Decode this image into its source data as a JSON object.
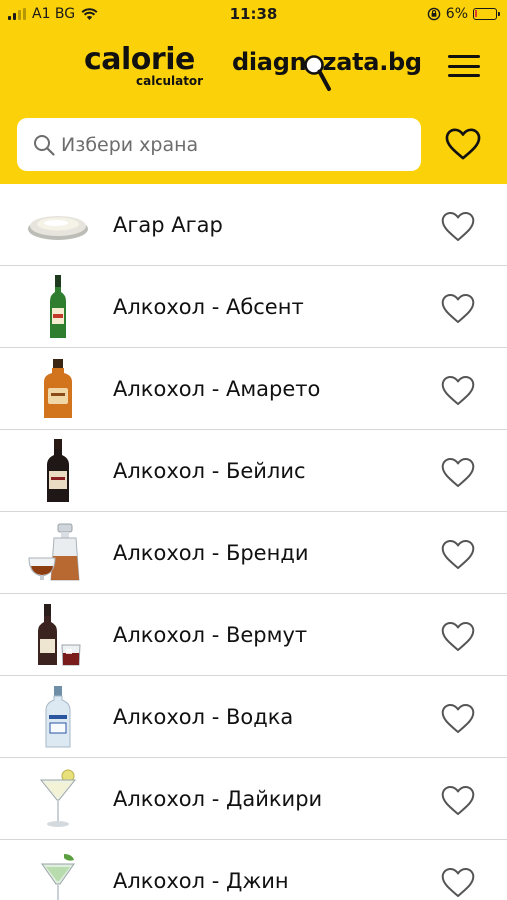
{
  "status_bar": {
    "carrier": "A1 BG",
    "time": "11:38",
    "battery": "6%"
  },
  "header": {
    "brand_main": "calorie",
    "brand_sub": "calculator",
    "partner": "diagnozata.bg"
  },
  "search": {
    "placeholder": "Избери храна"
  },
  "foods": [
    {
      "name": "Агар Агар",
      "image": "agar-bowl"
    },
    {
      "name": "Алкохол - Абсент",
      "image": "absinthe-bottle"
    },
    {
      "name": "Алкохол - Амарето",
      "image": "amaretto-bottle"
    },
    {
      "name": "Алкохол - Бейлис",
      "image": "baileys-bottle"
    },
    {
      "name": "Алкохол - Бренди",
      "image": "brandy-decanter"
    },
    {
      "name": "Алкохол - Вермут",
      "image": "vermouth-bottle"
    },
    {
      "name": "Алкохол - Водка",
      "image": "vodka-bottle"
    },
    {
      "name": "Алкохол - Дайкири",
      "image": "daiquiri-glass"
    },
    {
      "name": "Алкохол - Джин",
      "image": "gin-glass"
    }
  ],
  "colors": {
    "brand_yellow": "#fbd109",
    "divider": "#d6d6d6",
    "heart_stroke": "#555555"
  }
}
